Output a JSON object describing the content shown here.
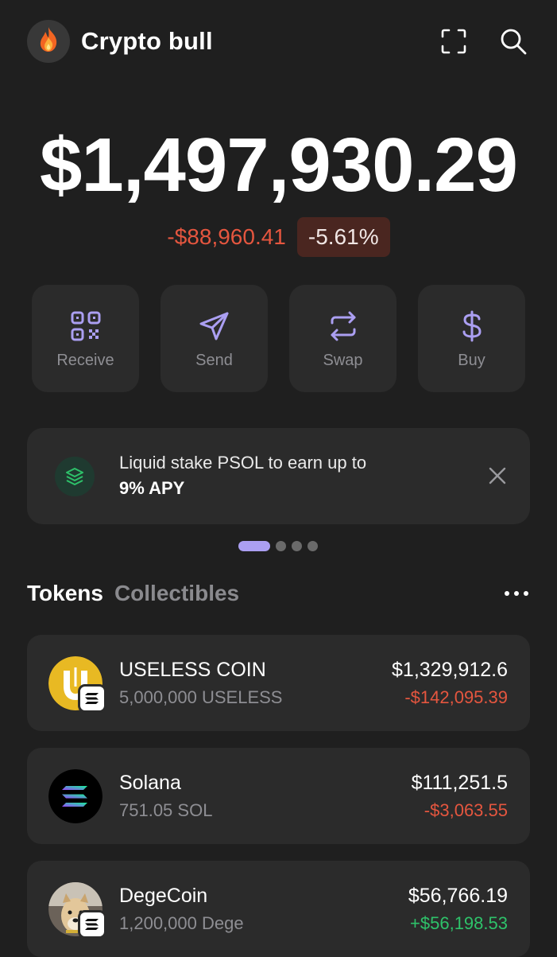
{
  "header": {
    "account_name": "Crypto bull",
    "avatar_emoji_icon": "fire-icon",
    "scan_icon": "scan-icon",
    "search_icon": "search-icon"
  },
  "portfolio": {
    "balance": "$1,497,930.29",
    "change_abs": "-$88,960.41",
    "change_pct": "-5.61%"
  },
  "actions": [
    {
      "label": "Receive",
      "icon": "qr-code-icon"
    },
    {
      "label": "Send",
      "icon": "send-icon"
    },
    {
      "label": "Swap",
      "icon": "swap-icon"
    },
    {
      "label": "Buy",
      "icon": "dollar-icon"
    }
  ],
  "banner": {
    "text": "Liquid stake PSOL to earn up to",
    "highlight": "9% APY",
    "icon": "stake-layers-icon"
  },
  "carousel": {
    "pages": 4,
    "active_index": 0
  },
  "tabs": [
    {
      "label": "Tokens",
      "active": true
    },
    {
      "label": "Collectibles",
      "active": false
    }
  ],
  "tokens": [
    {
      "name": "USELESS COIN",
      "amount": "5,000,000 USELESS",
      "value": "$1,329,912.6",
      "change": "-$142,095.39",
      "direction": "down"
    },
    {
      "name": "Solana",
      "amount": "751.05 SOL",
      "value": "$111,251.5",
      "change": "-$3,063.55",
      "direction": "down"
    },
    {
      "name": "DegeCoin",
      "amount": "1,200,000 Dege",
      "value": "$56,766.19",
      "change": "+$56,198.53",
      "direction": "up"
    }
  ],
  "colors": {
    "background": "#1f1f1f",
    "card": "#2b2b2b",
    "accent": "#ab9ff2",
    "negative": "#e5563f",
    "positive": "#2ec26a"
  }
}
